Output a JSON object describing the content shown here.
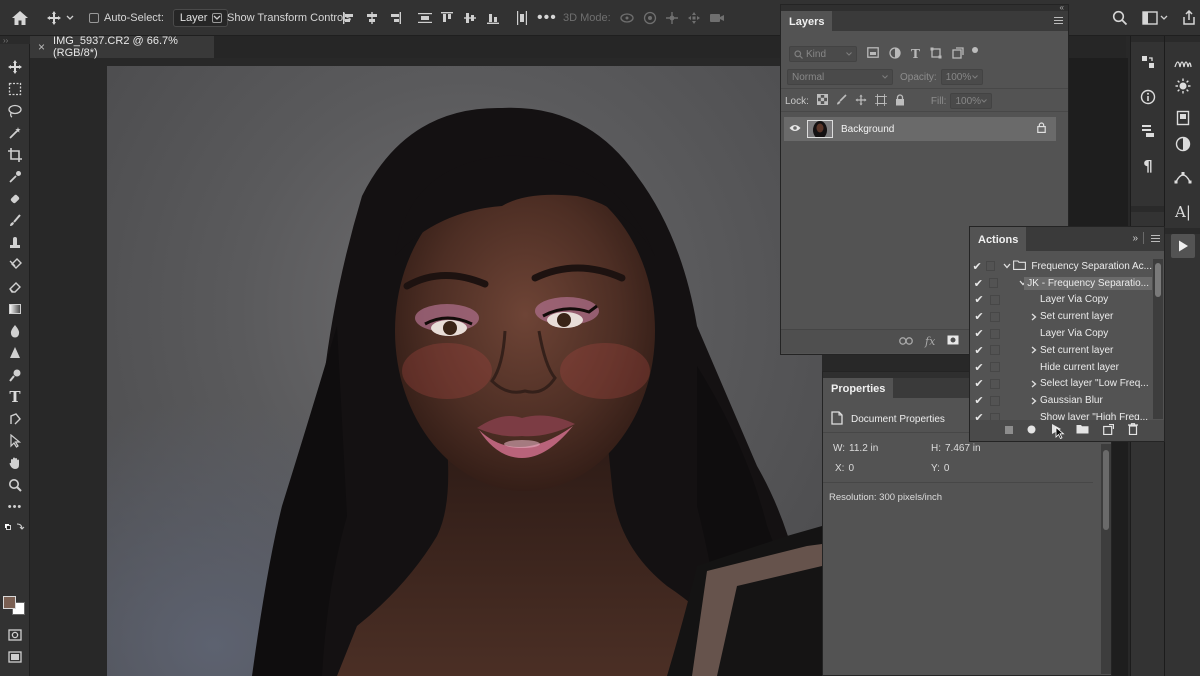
{
  "optbar": {
    "auto_select_label": "Auto-Select:",
    "auto_select_value": "Layer",
    "show_transform_label": "Show Transform Controls",
    "mode_3d_label": "3D Mode:"
  },
  "document": {
    "tab_title": "IMG_5937.CR2 @ 66.7% (RGB/8*)",
    "close_glyph": "×"
  },
  "layers": {
    "title": "Layers",
    "kind_label": "Kind",
    "blend_mode": "Normal",
    "opacity_label": "Opacity:",
    "opacity_value": "100%",
    "lock_label": "Lock:",
    "fill_label": "Fill:",
    "fill_value": "100%",
    "layer_name": "Background",
    "fx_label": "fx"
  },
  "actions": {
    "title": "Actions",
    "rows": [
      {
        "label": "Frequency Separation Ac...",
        "level": 0,
        "expander": "open",
        "folder": true
      },
      {
        "label": "JK - Frequency Separatio...",
        "level": 1,
        "expander": "open",
        "selected": true
      },
      {
        "label": "Layer Via Copy",
        "level": 2,
        "expander": ""
      },
      {
        "label": "Set current layer",
        "level": 2,
        "expander": "closed"
      },
      {
        "label": "Layer Via Copy",
        "level": 2,
        "expander": ""
      },
      {
        "label": "Set current layer",
        "level": 2,
        "expander": "closed"
      },
      {
        "label": "Hide current layer",
        "level": 2,
        "expander": ""
      },
      {
        "label": "Select layer \"Low Freq...",
        "level": 2,
        "expander": "closed"
      },
      {
        "label": "Gaussian Blur",
        "level": 2,
        "expander": "closed"
      },
      {
        "label": "Show layer \"High Freq...",
        "level": 2,
        "expander": ""
      }
    ]
  },
  "properties": {
    "title": "Properties",
    "section": "Document Properties",
    "w_label": "W:",
    "w_value": "11.2 in",
    "h_label": "H:",
    "h_value": "7.467 in",
    "x_label": "X:",
    "x_value": "0",
    "y_label": "Y:",
    "y_value": "0",
    "resolution": "Resolution: 300 pixels/inch"
  },
  "colors": {
    "foreground": "#7a5f52",
    "background": "#ffffff"
  }
}
